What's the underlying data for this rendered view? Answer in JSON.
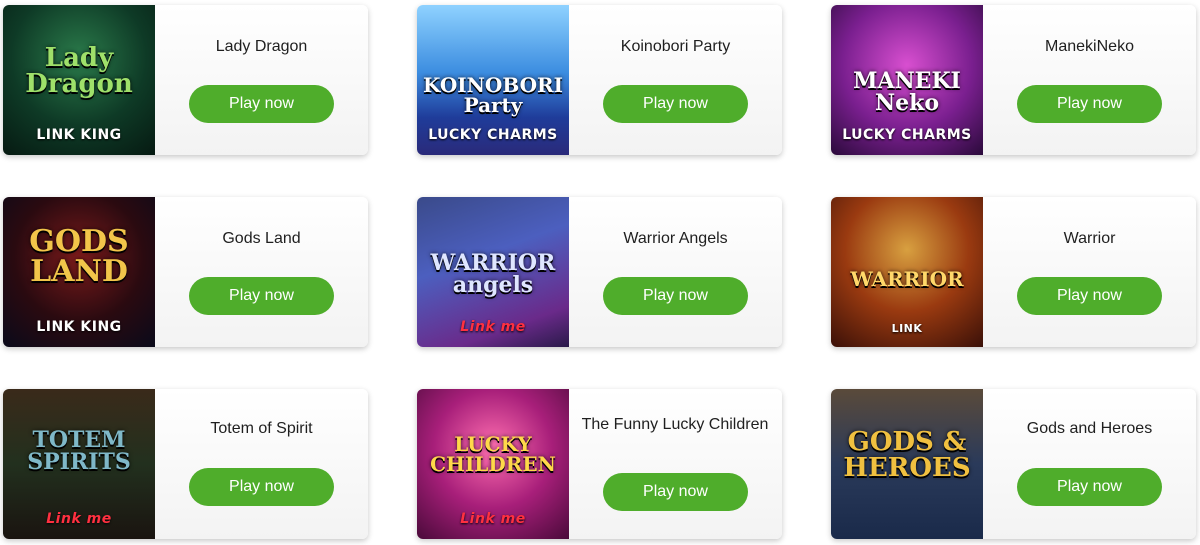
{
  "games": [
    {
      "name": "Lady Dragon",
      "button": "Play now",
      "art": {
        "title": "Lady Dragon",
        "badge": "LINK KING",
        "title_color": "#9fe06a"
      }
    },
    {
      "name": "Koinobori Party",
      "button": "Play now",
      "art": {
        "title": "KOINOBORI Party",
        "badge": "LUCKY CHARMS",
        "title_color": "#ffffff"
      }
    },
    {
      "name": "ManekiNeko",
      "button": "Play now",
      "art": {
        "title": "MANEKI Neko",
        "badge": "LUCKY CHARMS",
        "title_color": "#ffffff"
      }
    },
    {
      "name": "Gods Land",
      "button": "Play now",
      "art": {
        "title": "GODS LAND",
        "badge": "LINK KING",
        "title_color": "#f2c54a"
      }
    },
    {
      "name": "Warrior Angels",
      "button": "Play now",
      "art": {
        "title": "WARRIOR angels",
        "badge": "Link me",
        "title_color": "#dfe6ff"
      }
    },
    {
      "name": "Warrior",
      "button": "Play now",
      "art": {
        "title": "WARRIOR",
        "badge": "LINK",
        "title_color": "#ffd86a"
      }
    },
    {
      "name": "Totem of Spirit",
      "button": "Play now",
      "art": {
        "title": "TOTEM SPIRITS",
        "badge": "Link me",
        "title_color": "#7fb8c8"
      }
    },
    {
      "name": "The Funny Lucky Children",
      "button": "Play now",
      "art": {
        "title": "LUCKY CHILDREN",
        "badge": "Link me",
        "title_color": "#ffd84a"
      }
    },
    {
      "name": "Gods and Heroes",
      "button": "Play now",
      "art": {
        "title": "GODS & HEROES",
        "badge": "",
        "title_color": "#f0c040"
      }
    }
  ],
  "colors": {
    "button_bg": "#4fad2b",
    "button_text": "#ffffff",
    "card_bg": "#f7f7f7"
  }
}
